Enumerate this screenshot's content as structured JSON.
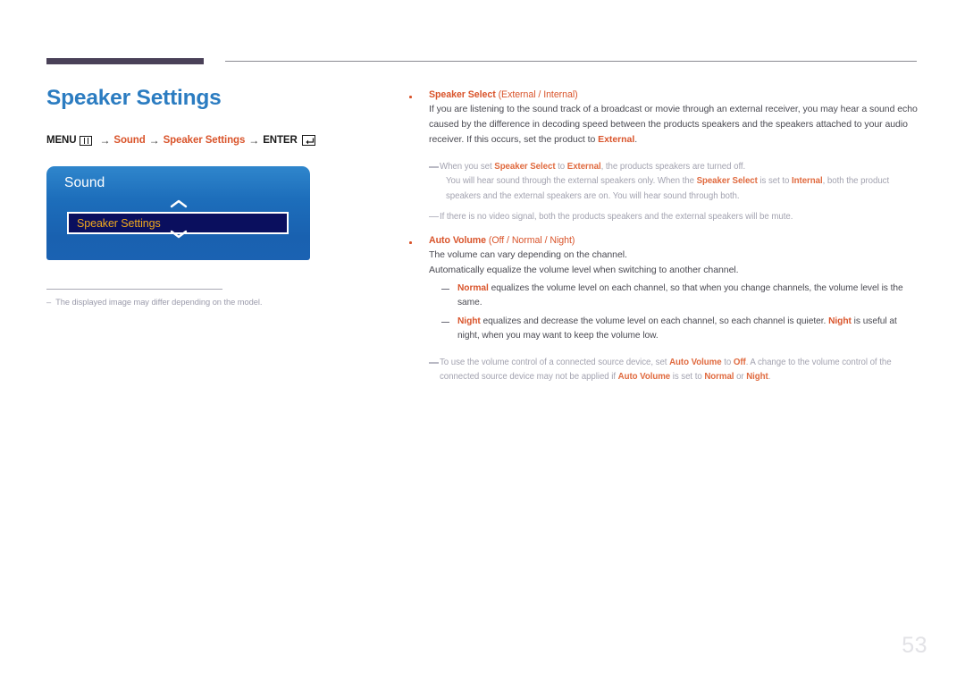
{
  "header": {
    "rule_thick_color": "#4a4158",
    "rule_thin_color": "#8b8b92"
  },
  "left": {
    "title": "Speaker Settings",
    "breadcrumb": {
      "menu_label": "MENU",
      "menu_icon": "menu-grid-icon",
      "arrow": "→",
      "path1": "Sound",
      "path2": "Speaker Settings",
      "enter_label": "ENTER",
      "enter_icon": "enter-return-icon",
      "accent_color": "#d9542b"
    },
    "osd": {
      "title": "Sound",
      "up_icon": "chevron-up-icon",
      "down_icon": "chevron-down-icon",
      "selected_row": "Speaker Settings",
      "row_text_color": "#f0a81e",
      "box_color": "#1d6ebb"
    },
    "footnote": {
      "dash": "–",
      "text": "The displayed image may differ depending on the model."
    }
  },
  "right": {
    "sections": [
      {
        "head_bold": "Speaker Select",
        "head_paren": " (External / Internal)",
        "body": "If you are listening to the sound track of a broadcast or movie through an external receiver, you may hear a sound echo caused by the difference in decoding speed between the products speakers and the speakers attached to your audio receiver. If this occurs, set the product to ",
        "body_tail_hl": "External",
        "body_tail": "."
      },
      {
        "head_bold": "Auto Volume",
        "head_paren": " (Off / Normal / Night)",
        "body1": "The volume can vary depending on the channel.",
        "body2": "Automatically equalize the volume level when switching to another channel."
      }
    ],
    "note1_line1_a": "When you set ",
    "note1_line1_hl1": "Speaker Select",
    "note1_line1_b": " to ",
    "note1_line1_hl2": "External",
    "note1_line1_c": ", the products speakers are turned off.",
    "note1_line2_a": "You will hear sound through the external speakers only. When the ",
    "note1_line2_hl1": "Speaker Select",
    "note1_line2_b": " is set to ",
    "note1_line2_hl2": "Internal",
    "note1_line2_c": ", both the product speakers and the external speakers are on. You will hear sound through both.",
    "note2": "If there is no video signal, both the products speakers and the external speakers will be mute.",
    "sub1_hl": "Normal",
    "sub1_text": " equalizes the volume level on each channel, so that when you change channels, the volume level is the same.",
    "sub2_hl": "Night",
    "sub2_text_a": " equalizes and decrease the volume level on each channel, so each channel is quieter. ",
    "sub2_hl2": "Night",
    "sub2_text_b": " is useful at night, when you may want to keep the volume low.",
    "note3_a": "To use the volume control of a connected source device, set ",
    "note3_hl1": "Auto Volume",
    "note3_b": " to ",
    "note3_hl2": "Off",
    "note3_c": ". A change to the volume control of the connected source device may not be applied if ",
    "note3_hl3": "Auto Volume",
    "note3_d": " is set to ",
    "note3_hl4": "Normal",
    "note3_e": " or ",
    "note3_hl5": "Night",
    "note3_f": "."
  },
  "page_number": "53"
}
